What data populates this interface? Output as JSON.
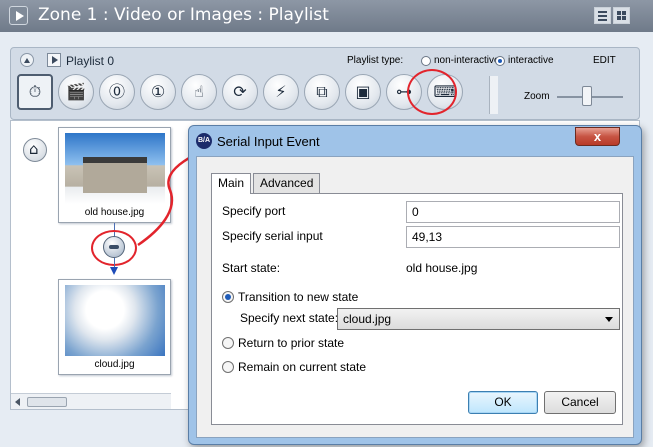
{
  "zone": {
    "title": "Zone 1 : Video or Images :  Playlist"
  },
  "playlist": {
    "name": "Playlist 0",
    "type_label": "Playlist type:",
    "options": [
      "non-interactive",
      "interactive"
    ],
    "selected": "interactive",
    "edit_label": "EDIT",
    "zoom_label": "Zoom",
    "zoom_level": 0.45,
    "tools": [
      {
        "name": "timeout-tool-icon",
        "glyph": "⏱"
      },
      {
        "name": "video-end-tool-icon",
        "glyph": "🎬"
      },
      {
        "name": "zone-message-tool-icon",
        "glyph": "⓪"
      },
      {
        "name": "user-variable-tool-icon",
        "glyph": "①"
      },
      {
        "name": "touch-tool-icon",
        "glyph": "☝"
      },
      {
        "name": "refresh-tool-icon",
        "glyph": "⟳"
      },
      {
        "name": "cable-tool-icon",
        "glyph": "⚡"
      },
      {
        "name": "copy-tool-icon",
        "glyph": "⧉"
      },
      {
        "name": "screen-tool-icon",
        "glyph": "▣"
      },
      {
        "name": "serial-port-tool-icon",
        "glyph": "⊶"
      },
      {
        "name": "keyboard-tool-icon",
        "glyph": "⌨"
      }
    ]
  },
  "canvas": {
    "states": [
      {
        "caption": "old house.jpg"
      },
      {
        "caption": "cloud.jpg"
      }
    ]
  },
  "dialog": {
    "icon_text": "B/A",
    "title": "Serial Input Event",
    "close_glyph": "x",
    "tabs": [
      "Main",
      "Advanced"
    ],
    "port_label": "Specify port",
    "port_value": "0",
    "serial_label": "Specify serial input",
    "serial_value": "49,13",
    "start_state_label": "Start state:",
    "start_state_value": "old house.jpg",
    "transition_label": "Transition to new state",
    "next_state_label": "Specify next state:",
    "next_state_value": "cloud.jpg",
    "return_label": "Return to prior state",
    "remain_label": "Remain on current state",
    "ok_label": "OK",
    "cancel_label": "Cancel"
  }
}
